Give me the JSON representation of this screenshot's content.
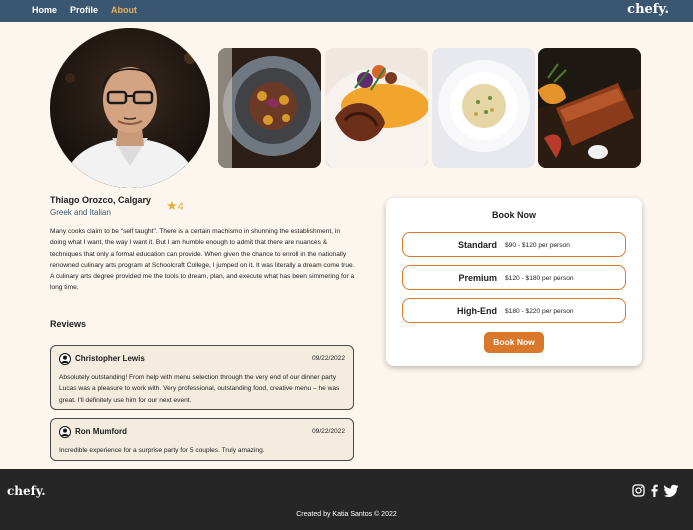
{
  "nav": {
    "links": [
      {
        "label": "Home",
        "active": false
      },
      {
        "label": "Profile",
        "active": false
      },
      {
        "label": "About",
        "active": true
      }
    ],
    "brand": "chefy."
  },
  "chef": {
    "name": "Thiago Orozco, Calgary",
    "cuisine": "Greek and Italian",
    "rating_icon": "star-icon",
    "rating": "4",
    "bio": "Many cooks claim to be \"self taught\". There is a certain machismo in shunning the establishment, in doing what I want, the way I want it. But I am humble enough to admit that there are nuances & techniques that only a formal education can provide. When given the chance to enroll in the nationally renowned culinary arts program at Schoolcraft College, I jumped on it. It was literally a dream come true. A culinary arts degree provided me the tools to dream, plan, and execute what has been simmering for a long time."
  },
  "gallery": [
    "dish-photo-1",
    "dish-photo-2",
    "dish-photo-3",
    "dish-photo-4"
  ],
  "reviews": {
    "title": "Reviews",
    "items": [
      {
        "name": "Christopher Lewis",
        "date": "09/22/2022",
        "text": "Absolutely outstanding! From help with menu selection through the very end of our dinner party Lucas was a pleasure to work with. Very professional, outstanding food, creative menu – he was great. I'll definitely use him for our next event."
      },
      {
        "name": "Ron Mumford",
        "date": "09/22/2022",
        "text": "Incredible experience for a surprise party for 5 couples. Truly amazing."
      }
    ]
  },
  "booking": {
    "title": "Book Now",
    "tiers": [
      {
        "name": "Standard",
        "price": "$90 - $120 per person"
      },
      {
        "name": "Premium",
        "price": "$120 - $180 per person"
      },
      {
        "name": "High-End",
        "price": "$180 - $220 per person"
      }
    ],
    "button": "Book Now"
  },
  "footer": {
    "brand": "chefy.",
    "credit": "Created by Katia Santos © 2022",
    "social": [
      "instagram-icon",
      "facebook-icon",
      "twitter-icon"
    ]
  },
  "colors": {
    "nav_bg": "#3b5670",
    "accent": "#d9772b",
    "active_link": "#e8b24f",
    "page_bg": "#fdf6ef",
    "footer_bg": "#262626"
  }
}
